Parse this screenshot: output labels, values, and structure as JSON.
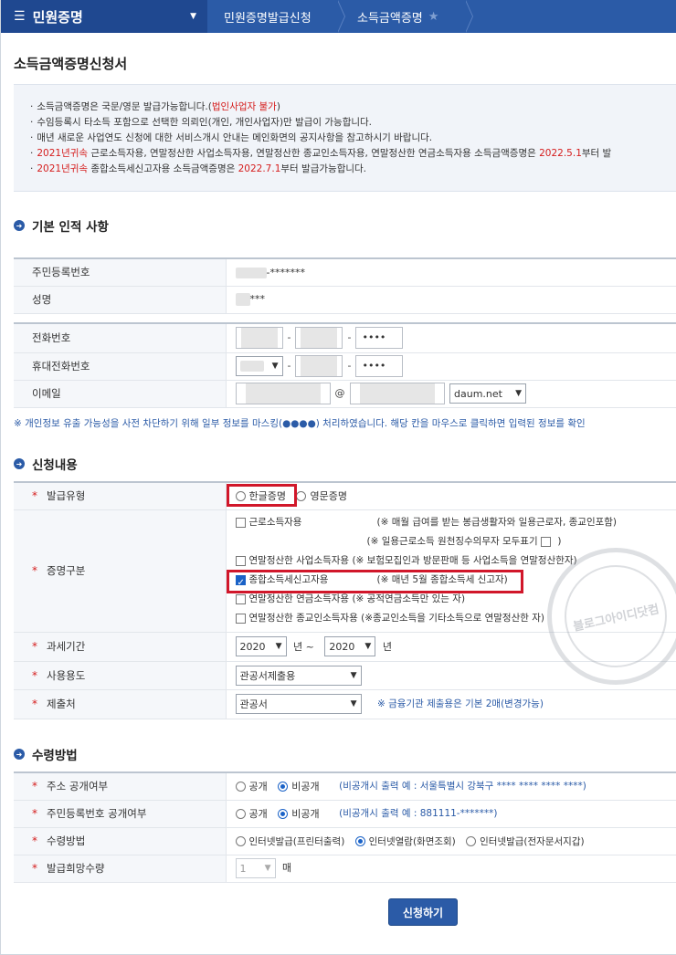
{
  "nav": {
    "menu_label": "민원증명",
    "crumb1": "민원증명발급신청",
    "crumb2": "소득금액증명"
  },
  "page_title": "소득금액증명신청서",
  "notice": {
    "l1_a": "소득금액증명은 국문/영문 발급가능합니다.(",
    "l1_red": "법인사업자 불가",
    "l1_b": ")",
    "l2": "수임등록시 타소득 포함으로 선택한 의뢰인(개인, 개인사업자)만 발급이 가능합니다.",
    "l3": "매년 새로운 사업연도 신청에 대한 서비스개시 안내는 메인화면의 공지사항을 참고하시기 바랍니다.",
    "l4_red1": "2021년귀속",
    "l4_a": " 근로소득자용, 연말정산한 사업소득자용, 연말정산한 종교인소득자용, 연말정산한 연금소득자용 소득금액증명은 ",
    "l4_red2": "2022.5.1",
    "l4_b": "부터 발",
    "l5_red1": "2021년귀속",
    "l5_a": " 종합소득세신고자용 소득금액증명은 ",
    "l5_red2": "2022.7.1",
    "l5_b": "부터 발급가능합니다."
  },
  "basic": {
    "heading": "기본 인적 사항",
    "rrn_label": "주민등록번호",
    "rrn_value": "-*******",
    "name_label": "성명",
    "name_value": "***",
    "phone_label": "전화번호",
    "phone_last": "••••",
    "mobile_label": "휴대전화번호",
    "mobile_last": "••••",
    "email_label": "이메일",
    "email_at": "@",
    "email_domain": "daum.net"
  },
  "mask_note": "※ 개인정보 유출 가능성을 사전 차단하기 위해 일부 정보를 마스킹(●●●●) 처리하였습니다. 해당 칸을 마우스로 클릭하면 입력된 정보를 확인",
  "apply": {
    "heading": "신청내용",
    "type_label": "발급유형",
    "type_korean": "한글증명",
    "type_english": "영문증명",
    "cert_label": "증명구분",
    "opt1": "근로소득자용",
    "opt1_note": "(※ 매월 급여를 받는 봉급생활자와 일용근로자, 종교인포함)",
    "opt1_sub": "(※ 일용근로소득 원천징수의무자 모두표기",
    "opt1_sub_end": ")",
    "opt2": "연말정산한 사업소득자용",
    "opt2_note": "(※ 보험모집인과 방문판매 등 사업소득을 연말정산한자)",
    "opt3": "종합소득세신고자용",
    "opt3_note": "(※ 매년 5월 종합소득세 신고자)",
    "opt4": "연말정산한 연금소득자용",
    "opt4_note": "(※ 공적연금소득만 있는 자)",
    "opt5": "연말정산한 종교인소득자용",
    "opt5_note": "(※종교인소득을 기타소득으로 연말정산한 자)",
    "period_label": "과세기간",
    "year_from": "2020",
    "year_unit1": "년 ~",
    "year_to": "2020",
    "year_unit2": "년",
    "usage_label": "사용용도",
    "usage_value": "관공서제출용",
    "submit_to_label": "제출처",
    "submit_to_value": "관공서",
    "submit_to_note": "※ 금융기관 제출용은 기본 2매(변경가능)"
  },
  "receive": {
    "heading": "수령방법",
    "addr_label": "주소 공개여부",
    "public": "공개",
    "private": "비공개",
    "addr_note": "(비공개시 출력 예 : 서울특별시 강북구 **** **** **** ****)",
    "rrn_label": "주민등록번호 공개여부",
    "rrn_note": "(비공개시 출력 예 : 881111-*******)",
    "method_label": "수령방법",
    "method1": "인터넷발급(프린터출력)",
    "method2": "인터넷열람(화면조회)",
    "method3": "인터넷발급(전자문서지갑)",
    "qty_label": "발급희망수량",
    "qty_value": "1",
    "qty_unit": "매"
  },
  "submit_label": "신청하기",
  "watermark": "블로그아이디닷컴",
  "colors": {
    "primary": "#2b5ba7",
    "highlight": "#d1172a",
    "alert": "#d51c1c"
  }
}
